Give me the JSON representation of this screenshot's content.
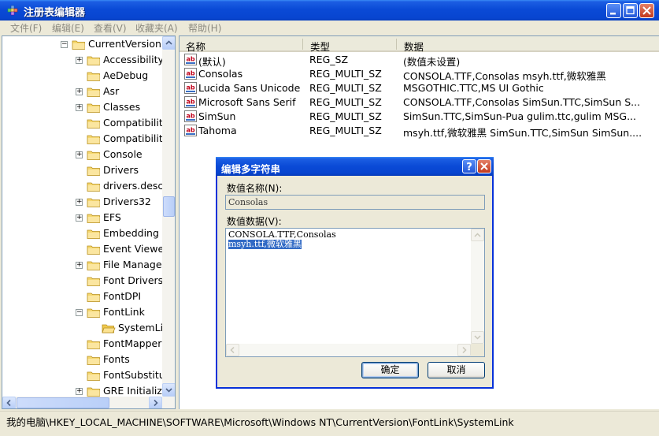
{
  "window": {
    "title": "注册表编辑器"
  },
  "menu": [
    {
      "label": "文件(F)"
    },
    {
      "label": "编辑(E)"
    },
    {
      "label": "查看(V)"
    },
    {
      "label": "收藏夹(A)"
    },
    {
      "label": "帮助(H)"
    }
  ],
  "tree": {
    "items": [
      {
        "label": "CurrentVersion",
        "expander": "−"
      },
      {
        "label": "Accessibility",
        "expander": "+"
      },
      {
        "label": "AeDebug",
        "expander": ""
      },
      {
        "label": "Asr",
        "expander": "+"
      },
      {
        "label": "Classes",
        "expander": "+"
      },
      {
        "label": "Compatibility",
        "expander": ""
      },
      {
        "label": "Compatibility",
        "expander": ""
      },
      {
        "label": "Console",
        "expander": "+"
      },
      {
        "label": "Drivers",
        "expander": ""
      },
      {
        "label": "drivers.desc",
        "expander": ""
      },
      {
        "label": "Drivers32",
        "expander": "+"
      },
      {
        "label": "EFS",
        "expander": "+"
      },
      {
        "label": "Embedding",
        "expander": ""
      },
      {
        "label": "Event Viewer",
        "expander": ""
      },
      {
        "label": "File Manage",
        "expander": "+"
      },
      {
        "label": "Font Drivers",
        "expander": ""
      },
      {
        "label": "FontDPI",
        "expander": ""
      },
      {
        "label": "FontLink",
        "expander": "−"
      },
      {
        "label": "SystemLin",
        "expander": ""
      },
      {
        "label": "FontMapper",
        "expander": ""
      },
      {
        "label": "Fonts",
        "expander": ""
      },
      {
        "label": "FontSubstitu",
        "expander": ""
      },
      {
        "label": "GRE Initialize",
        "expander": "+"
      }
    ]
  },
  "list": {
    "headers": {
      "name": "名称",
      "type": "类型",
      "data": "数据"
    },
    "rows": [
      {
        "name": "(默认)",
        "type": "REG_SZ",
        "data": "(数值未设置)"
      },
      {
        "name": "Consolas",
        "type": "REG_MULTI_SZ",
        "data": "CONSOLA.TTF,Consolas msyh.ttf,微软雅黑"
      },
      {
        "name": "Lucida Sans Unicode",
        "type": "REG_MULTI_SZ",
        "data": "MSGOTHIC.TTC,MS UI Gothic"
      },
      {
        "name": "Microsoft Sans Serif",
        "type": "REG_MULTI_SZ",
        "data": "CONSOLA.TTF,Consolas SimSun.TTC,SimSun S..."
      },
      {
        "name": "SimSun",
        "type": "REG_MULTI_SZ",
        "data": "SimSun.TTC,SimSun-Pua gulim.ttc,gulim MSG..."
      },
      {
        "name": "Tahoma",
        "type": "REG_MULTI_SZ",
        "data": "msyh.ttf,微软雅黑 SimSun.TTC,SimSun SimSun...."
      }
    ]
  },
  "dialog": {
    "title": "编辑多字符串",
    "name_label": "数值名称(N):",
    "name_value": "Consolas",
    "data_label": "数值数据(V):",
    "data_lines": [
      "CONSOLA.TTF,Consolas",
      "msyh.ttf,微软雅黑"
    ],
    "ok": "确定",
    "cancel": "取消"
  },
  "status": {
    "path": "我的电脑\\HKEY_LOCAL_MACHINE\\SOFTWARE\\Microsoft\\Windows NT\\CurrentVersion\\FontLink\\SystemLink"
  },
  "colors": {
    "titlebar": "#0a4ad6",
    "selection": "#316ac5",
    "folder": "#f5d76e",
    "window_bg": "#ece9d8"
  }
}
